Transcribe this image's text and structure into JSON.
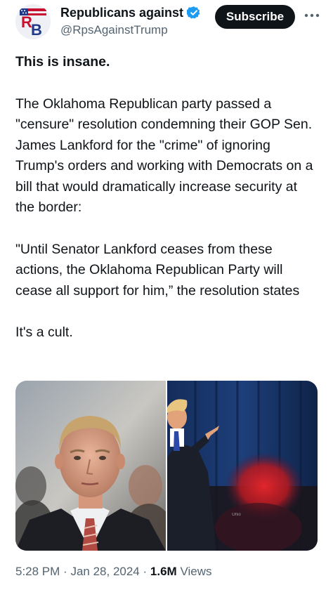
{
  "author": {
    "display_name": "Republicans against",
    "handle": "@RpsAgainstTrump",
    "avatar_initials": "RB"
  },
  "subscribe_label": "Subscribe",
  "tweet": {
    "paragraphs": [
      "This is insane.",
      "The Oklahoma Republican party passed a \"censure\" resolution condemning their GOP Sen. James Lankford for the \"crime\" of ignoring Trump's orders and working with Democrats on a bill that would dramatically increase security at the border:",
      "\"Until Senator Lankford ceases from these actions, the Oklahoma Republican Party will cease all support for him,” the resolution states",
      "It's a cult."
    ]
  },
  "meta": {
    "time": "5:28 PM",
    "separator": "·",
    "date": "Jan 28, 2024",
    "views_count": "1.6M",
    "views_label": "Views"
  },
  "colors": {
    "verified": "#1d9bf0",
    "text_primary": "#0f1419",
    "text_secondary": "#536471",
    "subscribe_bg": "#0f1419"
  }
}
